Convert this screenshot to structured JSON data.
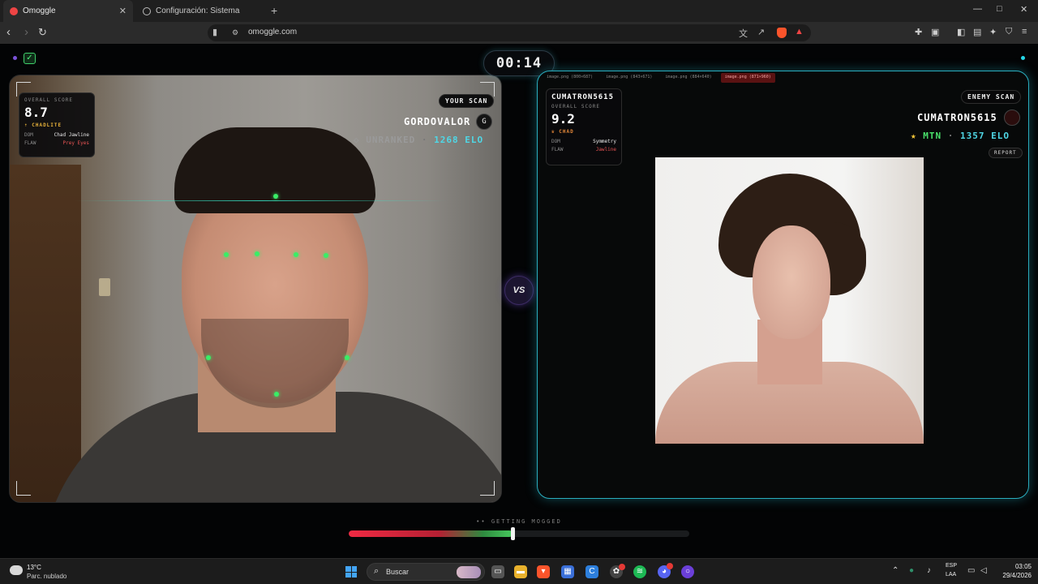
{
  "browser": {
    "tabs": [
      {
        "title": "Omoggle",
        "active": true
      },
      {
        "title": "Configuración: Sistema",
        "active": false
      }
    ],
    "new_tab": "+",
    "url": "omoggle.com",
    "window_controls": {
      "minimize": "—",
      "maximize": "□",
      "close": "✕"
    }
  },
  "app": {
    "timer": "00:14",
    "verified_mark": "✓",
    "vs_label": "VS",
    "you": {
      "scan_label": "YOUR SCAN",
      "username": "GORDOVALOR",
      "avatar_initial": "G",
      "rank": "UNRANKED",
      "elo": "1268 ELO",
      "card": {
        "overall_label": "OVERALL SCORE",
        "score": "8.7",
        "tier": "CHADLITE",
        "rows": [
          {
            "key": "DOM",
            "value": "Chad Jawline"
          },
          {
            "key": "FLAW",
            "value": "Prey Eyes"
          }
        ]
      }
    },
    "enemy": {
      "scan_label": "ENEMY SCAN",
      "username": "CUMATRON5615",
      "rank": "MTN",
      "elo": "1357 ELO",
      "report_label": "REPORT",
      "file_tabs": [
        "image.png (800×687)",
        "image.png (843×671)",
        "image.png (884×640)",
        "image.png (871×960)"
      ],
      "card": {
        "name": "CUMATRON5615",
        "overall_label": "OVERALL SCORE",
        "score": "9.2",
        "tier": "CHAD",
        "rows": [
          {
            "key": "DOM",
            "value": "Symmetry"
          },
          {
            "key": "FLAW",
            "value": "Jawline"
          }
        ]
      }
    },
    "mog_meter": {
      "label": "•• GETTING MOGGED",
      "level_fraction": 0.48
    }
  },
  "taskbar": {
    "weather_temp": "13°C",
    "weather_desc": "Parc. nublado",
    "search_label": "Buscar",
    "lang_line1": "ESP",
    "lang_line2": "LAA",
    "time": "03:05",
    "date": "29/4/2026"
  },
  "colors": {
    "accent_cyan": "#2aaebf",
    "landmark_green": "#39ee66",
    "tier_gold": "#e9b33a",
    "elo_cyan": "#4fd7e6",
    "rank_green": "#49e06a",
    "flaw_red": "#e85454"
  }
}
